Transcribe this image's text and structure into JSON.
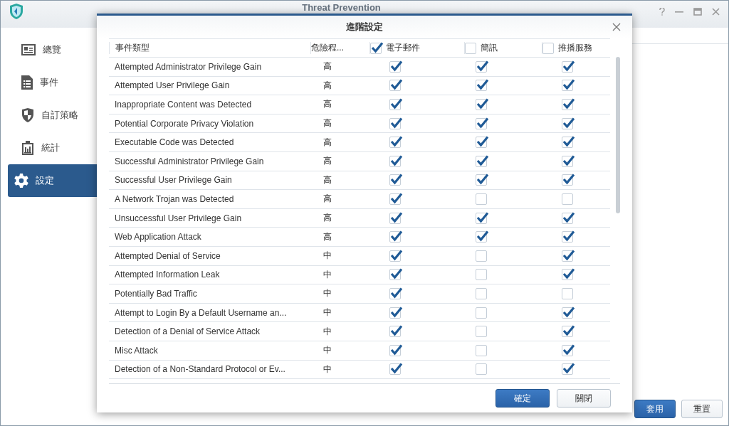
{
  "window": {
    "title": "Threat Prevention"
  },
  "sidebar": {
    "items": [
      {
        "label": "總覽",
        "kind": "overview",
        "selected": false
      },
      {
        "label": "事件",
        "kind": "events",
        "selected": false
      },
      {
        "label": "自訂策略",
        "kind": "shield",
        "selected": false
      },
      {
        "label": "統計",
        "kind": "stats",
        "selected": false
      },
      {
        "label": "設定",
        "kind": "settings",
        "selected": true
      }
    ]
  },
  "footer_buttons": [
    {
      "label": "套用",
      "kind": "primary"
    },
    {
      "label": "重置",
      "kind": "default"
    }
  ],
  "dialog": {
    "title": "進階設定",
    "columns": [
      {
        "label": "事件類型",
        "kind": "text"
      },
      {
        "label": "危險程...",
        "kind": "text"
      },
      {
        "label": "電子郵件",
        "kind": "check",
        "checked": true
      },
      {
        "label": "簡訊",
        "kind": "check",
        "checked": false
      },
      {
        "label": "推播服務",
        "kind": "check",
        "checked": false
      }
    ],
    "rows": [
      {
        "event": "Attempted Administrator Privilege Gain",
        "severity": "高",
        "email": true,
        "sms": true,
        "push": true
      },
      {
        "event": "Attempted User Privilege Gain",
        "severity": "高",
        "email": true,
        "sms": true,
        "push": true
      },
      {
        "event": "Inappropriate Content was Detected",
        "severity": "高",
        "email": true,
        "sms": true,
        "push": true
      },
      {
        "event": "Potential Corporate Privacy Violation",
        "severity": "高",
        "email": true,
        "sms": true,
        "push": true
      },
      {
        "event": "Executable Code was Detected",
        "severity": "高",
        "email": true,
        "sms": true,
        "push": true
      },
      {
        "event": "Successful Administrator Privilege Gain",
        "severity": "高",
        "email": true,
        "sms": true,
        "push": true
      },
      {
        "event": "Successful User Privilege Gain",
        "severity": "高",
        "email": true,
        "sms": true,
        "push": true
      },
      {
        "event": "A Network Trojan was Detected",
        "severity": "高",
        "email": true,
        "sms": false,
        "push": false
      },
      {
        "event": "Unsuccessful User Privilege Gain",
        "severity": "高",
        "email": true,
        "sms": true,
        "push": true
      },
      {
        "event": "Web Application Attack",
        "severity": "高",
        "email": true,
        "sms": true,
        "push": true
      },
      {
        "event": "Attempted Denial of Service",
        "severity": "中",
        "email": true,
        "sms": false,
        "push": true
      },
      {
        "event": "Attempted Information Leak",
        "severity": "中",
        "email": true,
        "sms": false,
        "push": true
      },
      {
        "event": "Potentially Bad Traffic",
        "severity": "中",
        "email": true,
        "sms": false,
        "push": false
      },
      {
        "event": "Attempt to Login By a Default Username an...",
        "severity": "中",
        "email": true,
        "sms": false,
        "push": true
      },
      {
        "event": "Detection of a Denial of Service Attack",
        "severity": "中",
        "email": true,
        "sms": false,
        "push": true
      },
      {
        "event": "Misc Attack",
        "severity": "中",
        "email": true,
        "sms": false,
        "push": true
      },
      {
        "event": "Detection of a Non-Standard Protocol or Ev...",
        "severity": "中",
        "email": true,
        "sms": false,
        "push": true
      }
    ],
    "buttons": [
      {
        "label": "確定",
        "kind": "primary"
      },
      {
        "label": "關閉",
        "kind": "default"
      }
    ]
  }
}
